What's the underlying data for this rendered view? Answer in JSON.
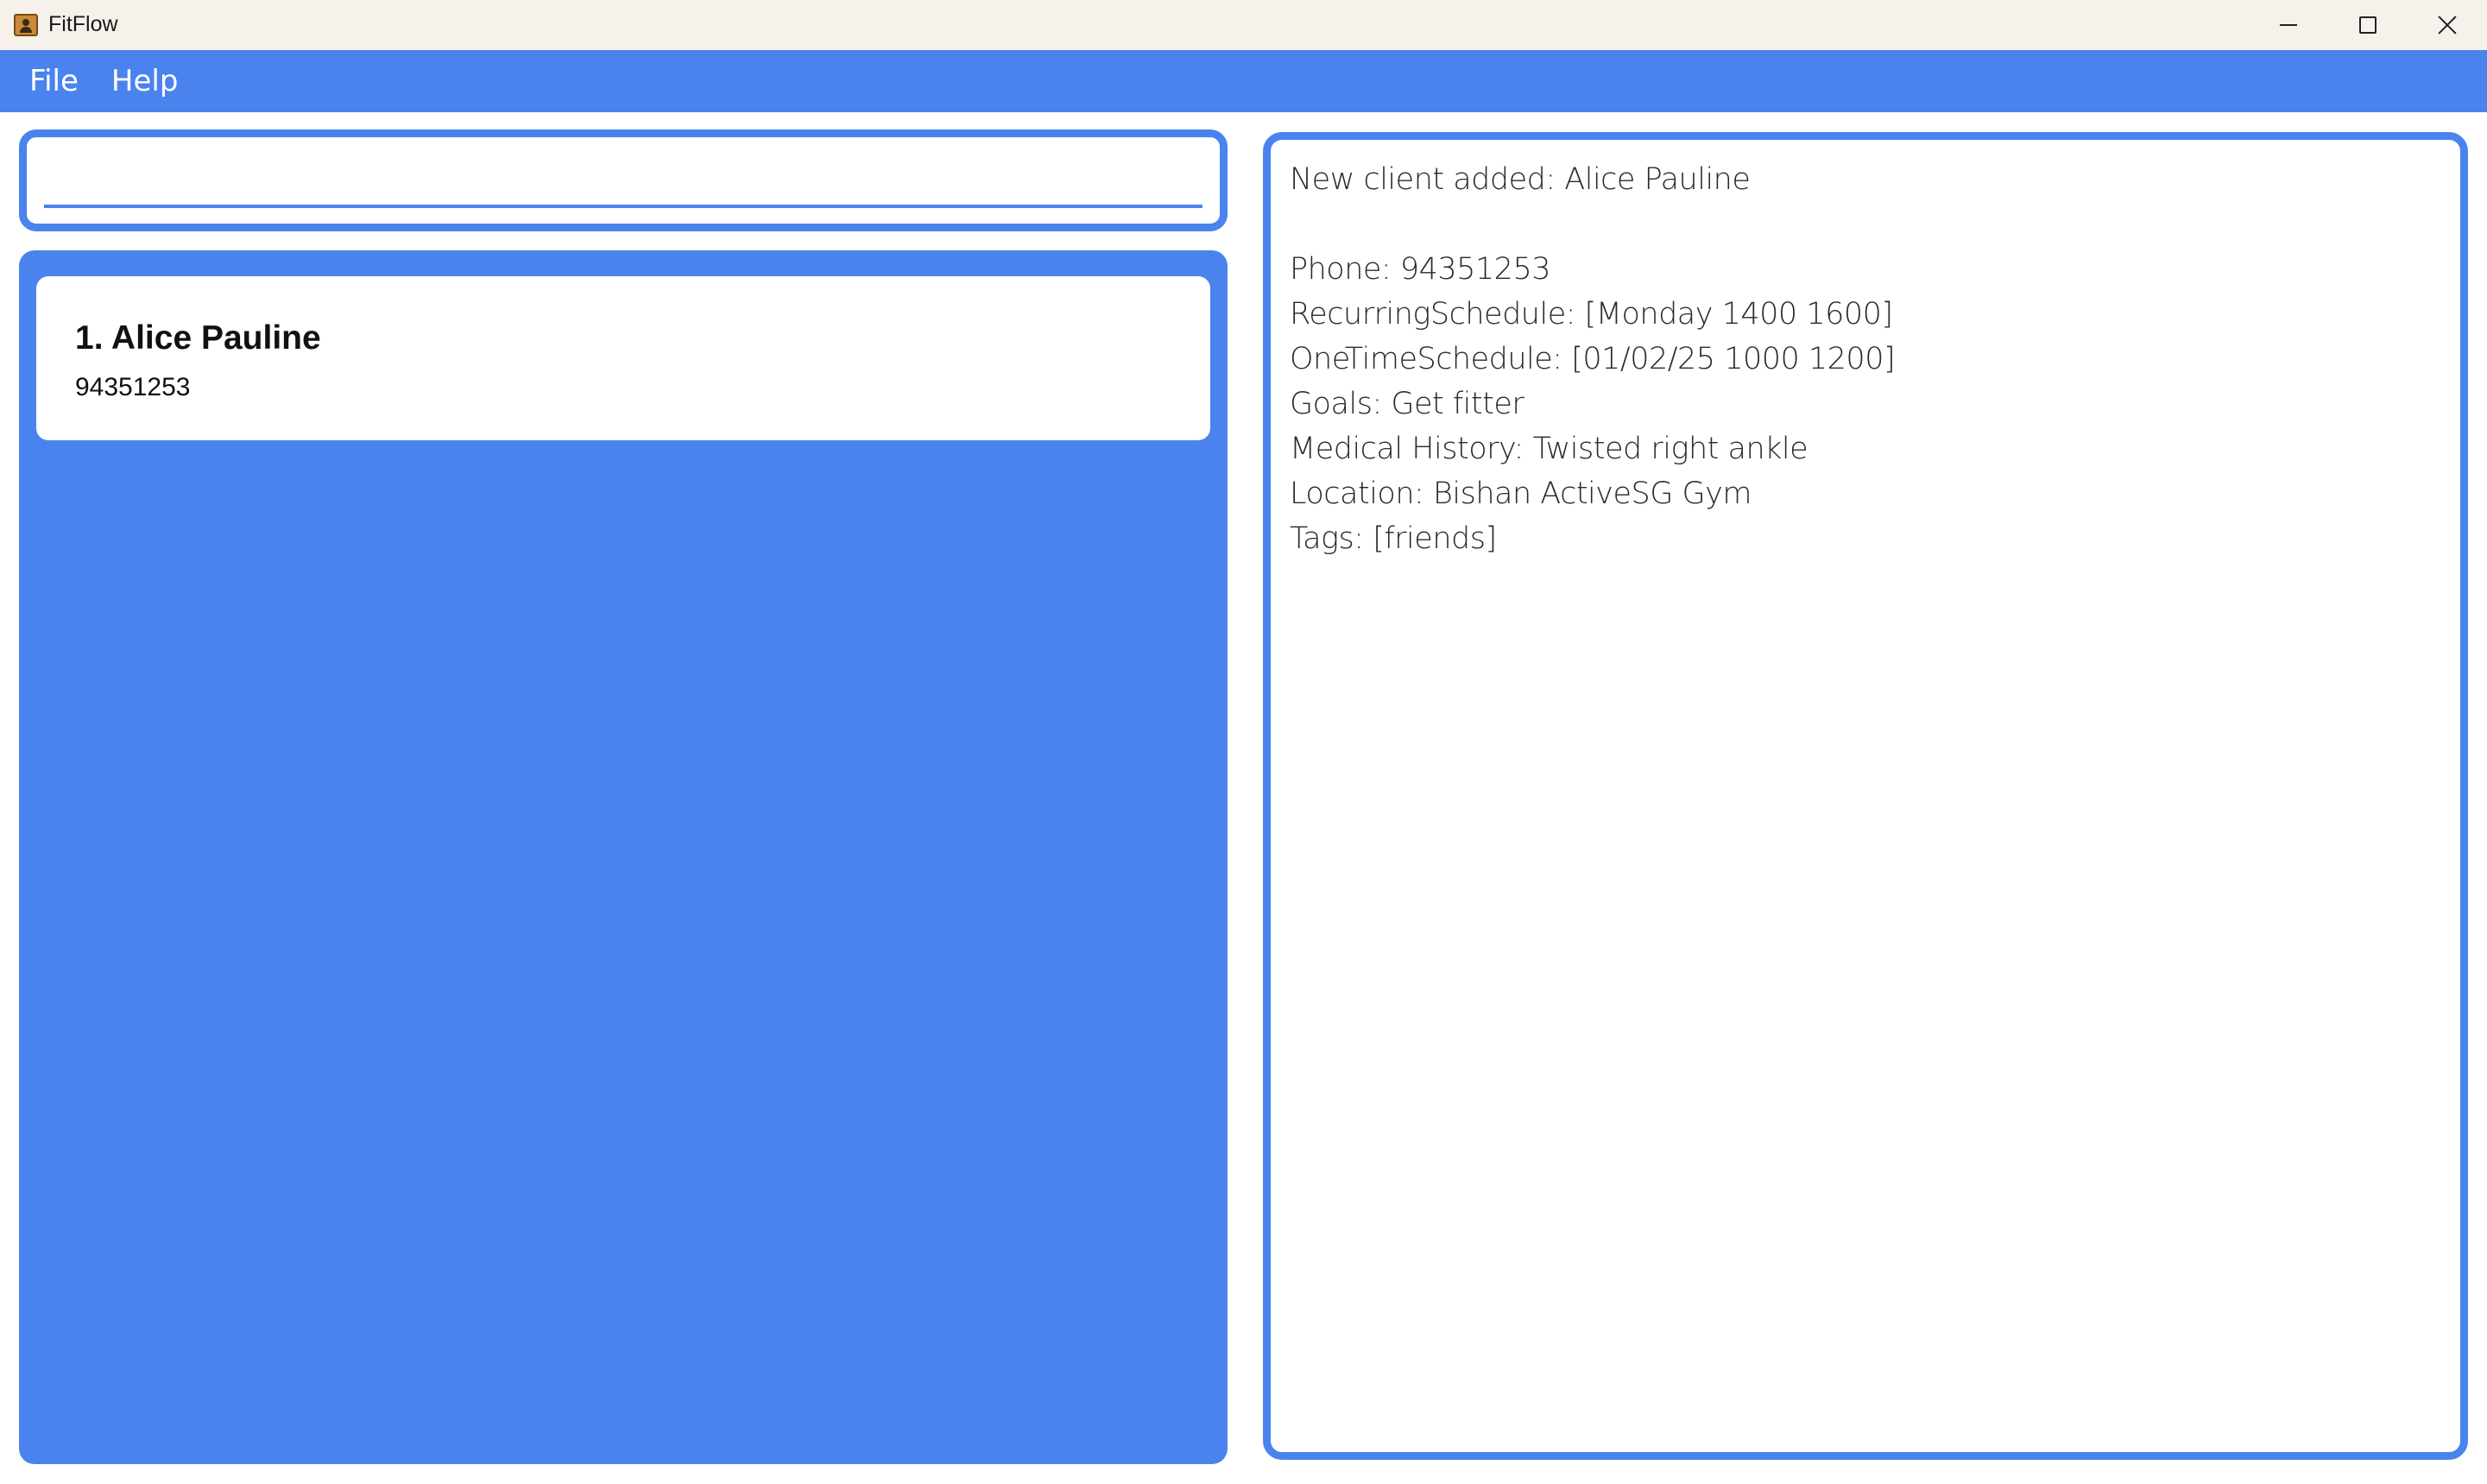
{
  "window": {
    "title": "FitFlow",
    "icon": "contact-card-icon"
  },
  "menu": {
    "items": [
      {
        "label": "File"
      },
      {
        "label": "Help"
      }
    ]
  },
  "command": {
    "value": "",
    "placeholder": ""
  },
  "clients": [
    {
      "index_name": "1. Alice Pauline",
      "phone": "94351253"
    }
  ],
  "result": {
    "header": "New client added: Alice Pauline",
    "lines": [
      "Phone: 94351253",
      "RecurringSchedule: [Monday 1400 1600]",
      "OneTimeSchedule: [01/02/25 1000 1200]",
      "Goals: Get fitter",
      "Medical History: Twisted right ankle",
      "Location: Bishan ActiveSG Gym",
      "Tags: [friends]"
    ]
  },
  "colors": {
    "accent": "#4a83ee",
    "titlebar": "#f7f1ec"
  }
}
